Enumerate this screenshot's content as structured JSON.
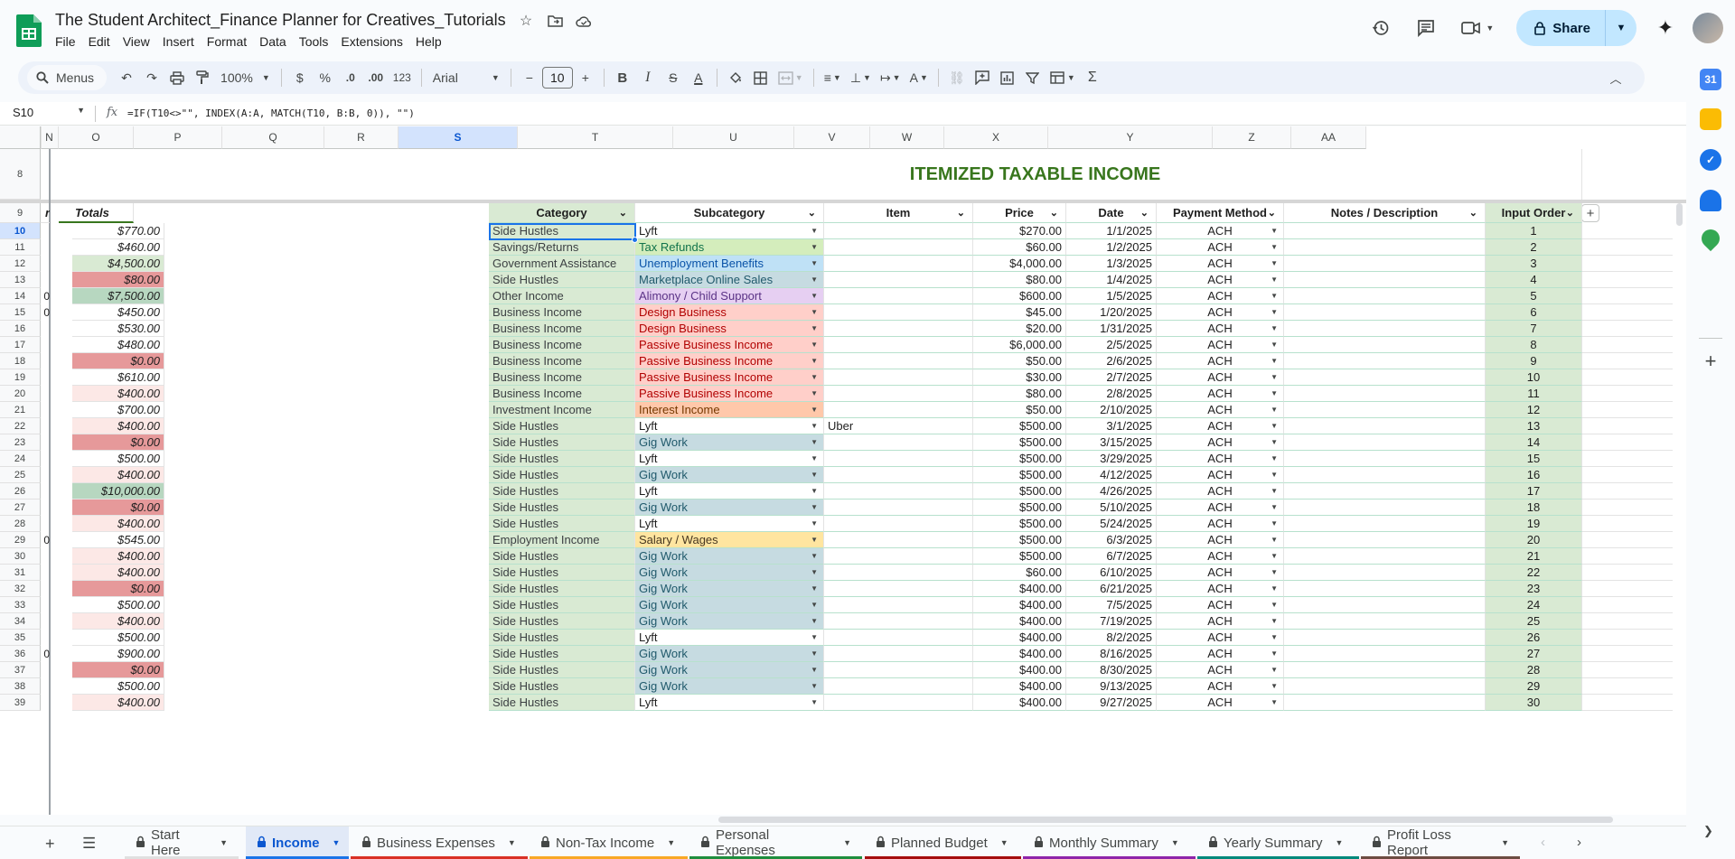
{
  "doc": {
    "title": "The Student Architect_Finance Planner for Creatives_Tutorials"
  },
  "menu": [
    "File",
    "Edit",
    "View",
    "Insert",
    "Format",
    "Data",
    "Tools",
    "Extensions",
    "Help"
  ],
  "share": {
    "label": "Share"
  },
  "toolbar": {
    "menus_label": "Menus",
    "zoom": "100%",
    "currency": "$",
    "percent": "%",
    "dec_decrease": ".0",
    "dec_increase": ".00",
    "number_format": "123",
    "font": "Arial",
    "font_size": "10"
  },
  "formula_bar": {
    "cell_ref": "S10",
    "fx": "fx",
    "formula": "=IF(T10<>\"\", INDEX(A:A, MATCH(T10, B:B, 0)), \"\")"
  },
  "columns": [
    "N",
    "O",
    "P",
    "Q",
    "R",
    "S",
    "T",
    "U",
    "V",
    "W",
    "X",
    "Y",
    "Z",
    "AA"
  ],
  "rows": [
    "8",
    "9",
    "10",
    "11",
    "12",
    "13",
    "14",
    "15",
    "16",
    "17",
    "18",
    "19",
    "20",
    "21",
    "22",
    "23",
    "24",
    "25",
    "26",
    "27",
    "28",
    "29",
    "30",
    "31",
    "32",
    "33",
    "34",
    "35",
    "36",
    "37",
    "38",
    "39"
  ],
  "totals": {
    "header_clip": "r",
    "header": "Totals",
    "values": [
      "$770.00",
      "$460.00",
      "$4,500.00",
      "$80.00",
      "$7,500.00",
      "$450.00",
      "$530.00",
      "$480.00",
      "$0.00",
      "$610.00",
      "$400.00",
      "$700.00",
      "$400.00",
      "$0.00",
      "$500.00",
      "$400.00",
      "$10,000.00",
      "$0.00",
      "$400.00",
      "$545.00",
      "$400.00",
      "$400.00",
      "$0.00",
      "$500.00",
      "$400.00",
      "$500.00",
      "$900.00",
      "$0.00",
      "$500.00",
      "$400.00"
    ],
    "clipped_zero": [
      "",
      "",
      "",
      "",
      "0",
      "0",
      "",
      "",
      "",
      "",
      "",
      "",
      "",
      "",
      "",
      "",
      "",
      "",
      "",
      "0",
      "",
      "",
      "",
      "",
      "",
      "",
      "0",
      "",
      "",
      ""
    ]
  },
  "section_title": "ITEMIZED TAXABLE INCOME",
  "table_headers": [
    "Category",
    "Subcategory",
    "Item",
    "Price",
    "Date",
    "Payment Method",
    "Notes / Description",
    "Input Order"
  ],
  "table_rows": [
    [
      "Side Hustles",
      "Lyft",
      "",
      "$270.00",
      "1/1/2025",
      "ACH",
      "",
      "1"
    ],
    [
      "Savings/Returns",
      "Tax Refunds",
      "",
      "$60.00",
      "1/2/2025",
      "ACH",
      "",
      "2"
    ],
    [
      "Government Assistance",
      "Unemployment Benefits",
      "",
      "$4,000.00",
      "1/3/2025",
      "ACH",
      "",
      "3"
    ],
    [
      "Side Hustles",
      "Marketplace Online Sales",
      "",
      "$80.00",
      "1/4/2025",
      "ACH",
      "",
      "4"
    ],
    [
      "Other Income",
      "Alimony / Child Support",
      "",
      "$600.00",
      "1/5/2025",
      "ACH",
      "",
      "5"
    ],
    [
      "Business Income",
      "Design Business",
      "",
      "$45.00",
      "1/20/2025",
      "ACH",
      "",
      "6"
    ],
    [
      "Business Income",
      "Design Business",
      "",
      "$20.00",
      "1/31/2025",
      "ACH",
      "",
      "7"
    ],
    [
      "Business Income",
      "Passive Business Income",
      "",
      "$6,000.00",
      "2/5/2025",
      "ACH",
      "",
      "8"
    ],
    [
      "Business Income",
      "Passive Business Income",
      "",
      "$50.00",
      "2/6/2025",
      "ACH",
      "",
      "9"
    ],
    [
      "Business Income",
      "Passive Business Income",
      "",
      "$30.00",
      "2/7/2025",
      "ACH",
      "",
      "10"
    ],
    [
      "Business Income",
      "Passive Business Income",
      "",
      "$80.00",
      "2/8/2025",
      "ACH",
      "",
      "11"
    ],
    [
      "Investment Income",
      "Interest Income",
      "",
      "$50.00",
      "2/10/2025",
      "ACH",
      "",
      "12"
    ],
    [
      "Side Hustles",
      "Lyft",
      "Uber",
      "$500.00",
      "3/1/2025",
      "ACH",
      "",
      "13"
    ],
    [
      "Side Hustles",
      "Gig Work",
      "",
      "$500.00",
      "3/15/2025",
      "ACH",
      "",
      "14"
    ],
    [
      "Side Hustles",
      "Lyft",
      "",
      "$500.00",
      "3/29/2025",
      "ACH",
      "",
      "15"
    ],
    [
      "Side Hustles",
      "Gig Work",
      "",
      "$500.00",
      "4/12/2025",
      "ACH",
      "",
      "16"
    ],
    [
      "Side Hustles",
      "Lyft",
      "",
      "$500.00",
      "4/26/2025",
      "ACH",
      "",
      "17"
    ],
    [
      "Side Hustles",
      "Gig Work",
      "",
      "$500.00",
      "5/10/2025",
      "ACH",
      "",
      "18"
    ],
    [
      "Side Hustles",
      "Lyft",
      "",
      "$500.00",
      "5/24/2025",
      "ACH",
      "",
      "19"
    ],
    [
      "Employment Income",
      "Salary / Wages",
      "",
      "$500.00",
      "6/3/2025",
      "ACH",
      "",
      "20"
    ],
    [
      "Side Hustles",
      "Gig Work",
      "",
      "$500.00",
      "6/7/2025",
      "ACH",
      "",
      "21"
    ],
    [
      "Side Hustles",
      "Gig Work",
      "",
      "$60.00",
      "6/10/2025",
      "ACH",
      "",
      "22"
    ],
    [
      "Side Hustles",
      "Gig Work",
      "",
      "$400.00",
      "6/21/2025",
      "ACH",
      "",
      "23"
    ],
    [
      "Side Hustles",
      "Gig Work",
      "",
      "$400.00",
      "7/5/2025",
      "ACH",
      "",
      "24"
    ],
    [
      "Side Hustles",
      "Gig Work",
      "",
      "$400.00",
      "7/19/2025",
      "ACH",
      "",
      "25"
    ],
    [
      "Side Hustles",
      "Lyft",
      "",
      "$400.00",
      "8/2/2025",
      "ACH",
      "",
      "26"
    ],
    [
      "Side Hustles",
      "Gig Work",
      "",
      "$400.00",
      "8/16/2025",
      "ACH",
      "",
      "27"
    ],
    [
      "Side Hustles",
      "Gig Work",
      "",
      "$400.00",
      "8/30/2025",
      "ACH",
      "",
      "28"
    ],
    [
      "Side Hustles",
      "Gig Work",
      "",
      "$400.00",
      "9/13/2025",
      "ACH",
      "",
      "29"
    ],
    [
      "Side Hustles",
      "Lyft",
      "",
      "$400.00",
      "9/27/2025",
      "ACH",
      "",
      "30"
    ]
  ],
  "chip_colors": {
    "Lyft": [
      "#ffffff",
      "#1f1f1f"
    ],
    "Tax Refunds": [
      "#d4edbc",
      "#11734b"
    ],
    "Unemployment Benefits": [
      "#bfe1f6",
      "#0a53a8"
    ],
    "Marketplace Online Sales": [
      "#c6dbe1",
      "#215a6c"
    ],
    "Alimony / Child Support": [
      "#e6cff2",
      "#5a3286"
    ],
    "Design Business": [
      "#ffcfc9",
      "#b10202"
    ],
    "Passive Business Income": [
      "#ffcfc9",
      "#b10202"
    ],
    "Interest Income": [
      "#ffc8aa",
      "#753800"
    ],
    "Gig Work": [
      "#c6dbe1",
      "#215a6c"
    ],
    "Salary / Wages": [
      "#ffe5a0",
      "#473821"
    ]
  },
  "colors": {
    "title_green": "#38761d",
    "category_bg": "#d9ead3",
    "row_border_green": "#b7e1cd",
    "totals_pink": "#fce8e6",
    "totals_red": "#e6999a",
    "totals_green": "#b7d7c0",
    "selection": "#1a73e8"
  },
  "tabs": [
    {
      "label": "Start Here",
      "locked": true,
      "color": "#e0e0e0",
      "active": false
    },
    {
      "label": "Income",
      "locked": true,
      "color": "#1a73e8",
      "active": true
    },
    {
      "label": "Business Expenses",
      "locked": true,
      "color": "#d93025",
      "active": false
    },
    {
      "label": "Non-Tax Income",
      "locked": true,
      "color": "#f9a825",
      "active": false
    },
    {
      "label": "Personal Expenses",
      "locked": true,
      "color": "#1e8e3e",
      "active": false
    },
    {
      "label": "Planned Budget",
      "locked": true,
      "color": "#a50e0e",
      "active": false
    },
    {
      "label": "Monthly Summary",
      "locked": true,
      "color": "#8e24aa",
      "active": false
    },
    {
      "label": "Yearly Summary",
      "locked": true,
      "color": "#00897b",
      "active": false
    },
    {
      "label": "Profit Loss Report",
      "locked": true,
      "color": "#6d4c41",
      "active": false
    }
  ]
}
